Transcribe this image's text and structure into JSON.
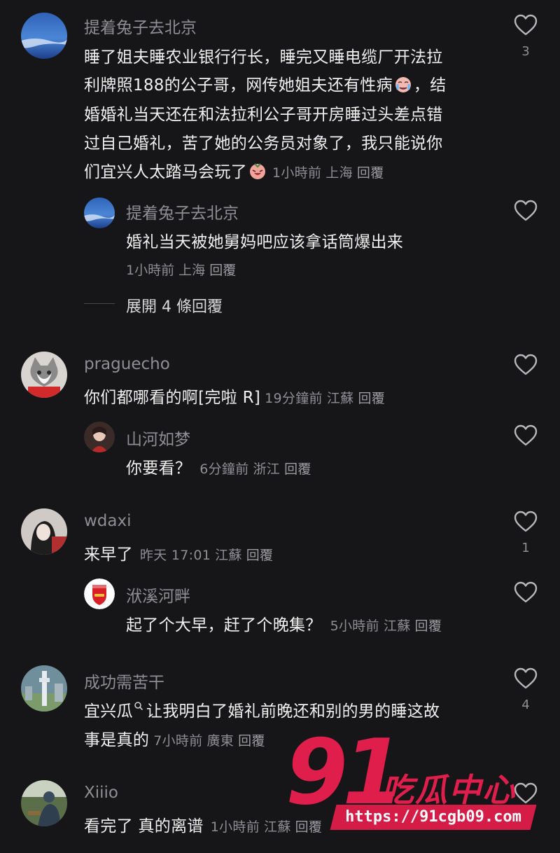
{
  "comments": [
    {
      "username": "提着兔子去北京",
      "lines": [
        "睡了姐夫睡农业银行行长，睡完又睡电缆厂开法拉",
        "利牌照188的公子哥，网传她姐夫还有性病",
        "婚婚礼当天还在和法拉利公子哥开房睡过头差点错",
        "过自己婚礼，苦了她的公务员对象了，我只能说你",
        "们宜兴人太踏马会玩了"
      ],
      "line2_suffix": "，结",
      "time": "1小時前",
      "location": "上海",
      "reply_label": "回覆",
      "like_count": "3"
    },
    {
      "username": "提着兔子去北京",
      "text": "婚礼当天被她舅妈吧应该拿话筒爆出来",
      "time": "1小時前",
      "location": "上海",
      "reply_label": "回覆"
    },
    {
      "username": "praguecho",
      "text": "你们都哪看的啊[完啦 R]",
      "time": "19分鐘前",
      "location": "江蘇",
      "reply_label": "回覆"
    },
    {
      "username": "山河如梦",
      "text": "你要看？",
      "time": "6分鐘前",
      "location": "浙江",
      "reply_label": "回覆"
    },
    {
      "username": "wdaxi",
      "text": "来早了",
      "time": "昨天 17:01",
      "location": "江蘇",
      "reply_label": "回覆",
      "like_count": "1"
    },
    {
      "username": "洑溪河畔",
      "text": "起了个大早，赶了个晚集？",
      "time": "5小時前",
      "location": "江蘇",
      "reply_label": "回覆"
    },
    {
      "username": "成功需苦干",
      "lines": [
        "让我明白了婚礼前晚还和别的男的睡这故",
        "事是真的"
      ],
      "search_term": "宜兴瓜",
      "time": "7小時前",
      "location": "廣東",
      "reply_label": "回覆",
      "like_count": "4"
    },
    {
      "username": "Xiiio",
      "text": "看完了 真的离谱",
      "time": "1小時前",
      "location": "江蘇",
      "reply_label": "回覆"
    }
  ],
  "expand_replies": "展開 4 條回覆",
  "watermark": {
    "number": "91",
    "name": "吃瓜中心",
    "url": "https://91cgb09.com"
  },
  "icons": {
    "like": "heart-outline-icon",
    "crying_emoji": "crying-face-emoji-icon",
    "laughing_emoji": "laughing-face-emoji-icon",
    "search": "search-icon"
  }
}
